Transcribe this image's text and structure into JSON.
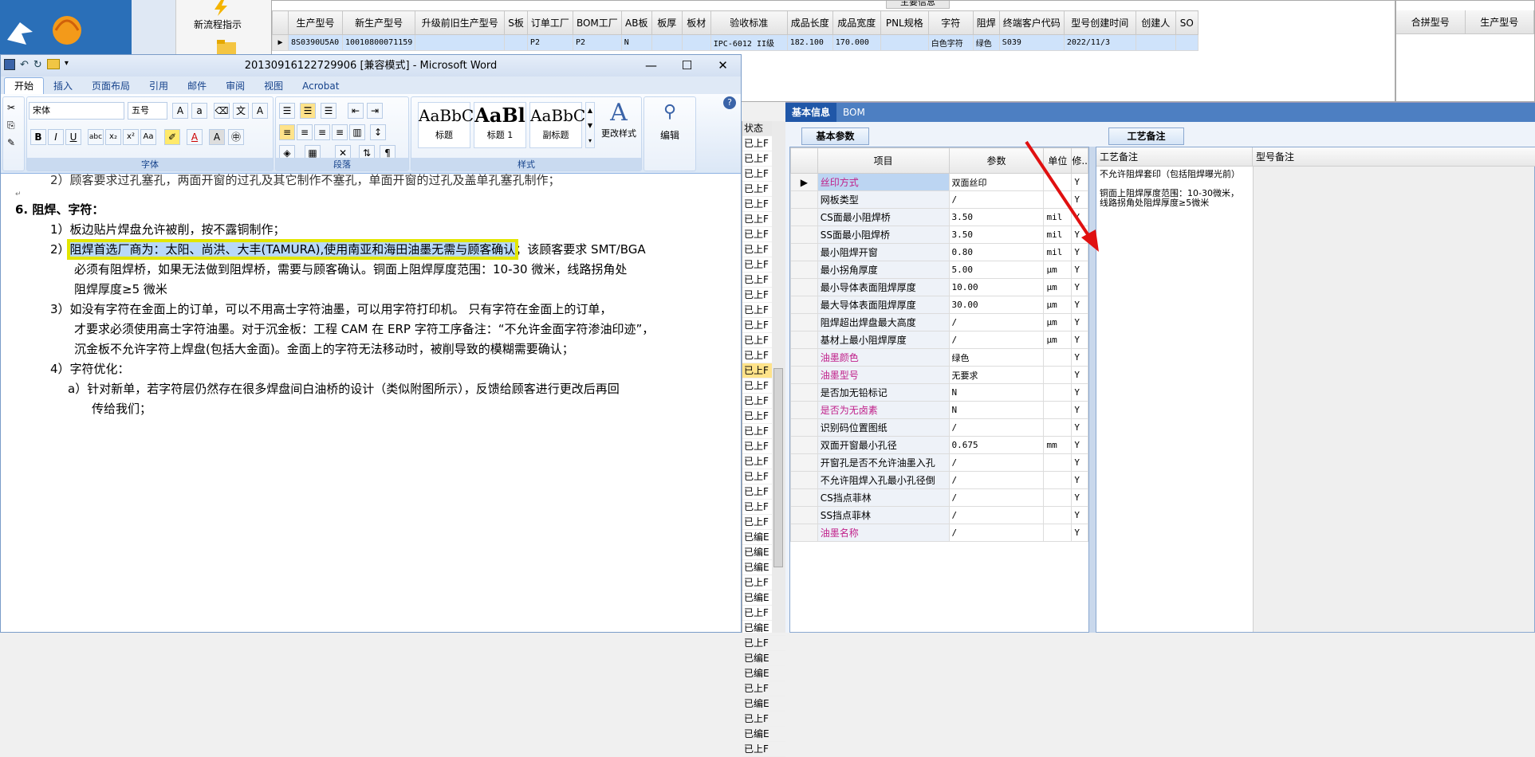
{
  "desktop": {
    "launcher_label": "新流程指示"
  },
  "main_grid": {
    "headers": [
      "生产型号",
      "新生产型号",
      "升级前旧生产型号",
      "S板",
      "订单工厂",
      "BOM工厂",
      "AB板",
      "板厚",
      "板材",
      "验收标准",
      "成品长度",
      "成品宽度",
      "PNL规格",
      "字符",
      "阻焊",
      "终端客户代码",
      "型号创建时间",
      "创建人",
      "SO"
    ],
    "row": [
      "8S0390U5A0",
      "10010800071159",
      "",
      "",
      "P2",
      "P2",
      "N",
      "",
      "",
      "IPC-6012 II级",
      "182.100",
      "170.000",
      "",
      "白色字符",
      "绿色",
      "S039",
      "2022/11/3",
      "",
      ""
    ],
    "top_label": "主要信息"
  },
  "right_grid": {
    "headers": [
      "合拼型号",
      "生产型号"
    ]
  },
  "word": {
    "title": "20130916122729906 [兼容模式] - Microsoft Word",
    "tabs": [
      "开始",
      "插入",
      "页面布局",
      "引用",
      "邮件",
      "审阅",
      "视图",
      "Acrobat"
    ],
    "font_name": "宋体",
    "font_size": "五号",
    "group_font": "字体",
    "group_para": "段落",
    "group_style": "样式",
    "styles": [
      {
        "sample": "AaBbC",
        "name": "标题"
      },
      {
        "sample": "AaBl",
        "name": "标题 1"
      },
      {
        "sample": "AaBbC",
        "name": "副标题"
      }
    ],
    "change_style": "更改样式",
    "edit": "编辑",
    "lines": {
      "l0": "2）顾客要求过孔塞孔，两面开窗的过孔及其它制作不塞孔，单面开窗的过孔及盖单孔塞孔制作；",
      "h6": "6.    阻焊、字符：",
      "p1": "1）板边贴片焊盘允许被削，按不露铜制作；",
      "p2a_hl": "阻焊首选厂商为：太阳、尚洪、大丰(TAMURA),使用南亚和海田油墨无需与顾客确认",
      "p2a_rest": "；该顾客要求 SMT/BGA",
      "p2b": "必须有阻焊桥，如果无法做到阻焊桥，需要与顾客确认。铜面上阻焊厚度范围：10-30 微米，线路拐角处",
      "p2c": "阻焊厚度≥5 微米",
      "p3a": "3）如没有字符在金面上的订单，可以不用高士字符油墨，可以用字符打印机。   只有字符在金面上的订单，",
      "p3b": "才要求必须使用高士字符油墨。对于沉金板：工程 CAM 在 ERP 字符工序备注：“不允许金面字符渗油印迹”，",
      "p3c": "沉金板不允许字符上焊盘(包括大金面)。金面上的字符无法移动时，被削导致的模糊需要确认；",
      "p4": "4）字符优化：",
      "pa1": "a）针对新单，若字符层仍然存在很多焊盘间白油桥的设计（类似附图所示），反馈给顾客进行更改后再回",
      "pa2": "传给我们；"
    }
  },
  "status_col": {
    "header": "状态",
    "rows": [
      "已上F",
      "已上F",
      "已上F",
      "已上F",
      "已上F",
      "已上F",
      "已上F",
      "已上F",
      "已上F",
      "已上F",
      "已上F",
      "已上F",
      "已上F",
      "已上F",
      "已上F",
      "已上F",
      "已上F",
      "已上F",
      "已上F",
      "已上F",
      "已上F",
      "已上F",
      "已上F",
      "已上F",
      "已上F",
      "已上F",
      "已编E",
      "已编E",
      "已编E",
      "已上F",
      "已编E",
      "已上F",
      "已编E",
      "已上F",
      "已编E",
      "已编E",
      "已上F",
      "已编E",
      "已上F",
      "已编E",
      "已上F"
    ]
  },
  "info_panel": {
    "tabs": [
      "基本信息",
      "BOM"
    ],
    "param_tab": "基本参数",
    "param_headers": [
      "项目",
      "参数",
      "单位",
      "修.."
    ],
    "params": [
      {
        "k": "丝印方式",
        "v": "双面丝印",
        "u": "",
        "f": "Y",
        "pink": true
      },
      {
        "k": "网板类型",
        "v": "/",
        "u": "",
        "f": "Y",
        "pink": false
      },
      {
        "k": "CS面最小阻焊桥",
        "v": "3.50",
        "u": "mil",
        "f": "Y",
        "pink": false
      },
      {
        "k": "SS面最小阻焊桥",
        "v": "3.50",
        "u": "mil",
        "f": "Y",
        "pink": false
      },
      {
        "k": "最小阻焊开窗",
        "v": "0.80",
        "u": "mil",
        "f": "Y",
        "pink": false
      },
      {
        "k": "最小拐角厚度",
        "v": "5.00",
        "u": "μm",
        "f": "Y",
        "pink": false
      },
      {
        "k": "最小导体表面阻焊厚度",
        "v": "10.00",
        "u": "μm",
        "f": "Y",
        "pink": false
      },
      {
        "k": "最大导体表面阻焊厚度",
        "v": "30.00",
        "u": "μm",
        "f": "Y",
        "pink": false
      },
      {
        "k": "阻焊超出焊盘最大高度",
        "v": "/",
        "u": "μm",
        "f": "Y",
        "pink": false
      },
      {
        "k": "基材上最小阻焊厚度",
        "v": "/",
        "u": "μm",
        "f": "Y",
        "pink": false
      },
      {
        "k": "油墨颜色",
        "v": "绿色",
        "u": "",
        "f": "Y",
        "pink": true
      },
      {
        "k": "油墨型号",
        "v": "无要求",
        "u": "",
        "f": "Y",
        "pink": true
      },
      {
        "k": "是否加无铅标记",
        "v": "N",
        "u": "",
        "f": "Y",
        "pink": false
      },
      {
        "k": "是否为无卤素",
        "v": "N",
        "u": "",
        "f": "Y",
        "pink": true
      },
      {
        "k": "识别码位置图纸",
        "v": "/",
        "u": "",
        "f": "Y",
        "pink": false
      },
      {
        "k": "双面开窗最小孔径",
        "v": "0.675",
        "u": "mm",
        "f": "Y",
        "pink": false
      },
      {
        "k": "开窗孔是否不允许油墨入孔",
        "v": "/",
        "u": "",
        "f": "Y",
        "pink": false
      },
      {
        "k": "不允许阻焊入孔最小孔径倒",
        "v": "/",
        "u": "",
        "f": "Y",
        "pink": false
      },
      {
        "k": "CS挡点菲林",
        "v": "/",
        "u": "",
        "f": "Y",
        "pink": false
      },
      {
        "k": "SS挡点菲林",
        "v": "/",
        "u": "",
        "f": "Y",
        "pink": false
      },
      {
        "k": "油墨名称",
        "v": "/",
        "u": "",
        "f": "Y",
        "pink": true
      }
    ],
    "craft_tab": "工艺备注",
    "craft_header": "工艺备注",
    "model_header": "型号备注",
    "craft_text1": "不允许阻焊套印（包括阻焊曝光前）",
    "craft_text2": "铜面上阻焊厚度范围：10-30微米，线路拐角处阻焊厚度≥5微米"
  },
  "colors": {
    "annotation_arrow": "#e01010",
    "highlight_box": "#e2e600",
    "selection": "#cfe3fb"
  }
}
